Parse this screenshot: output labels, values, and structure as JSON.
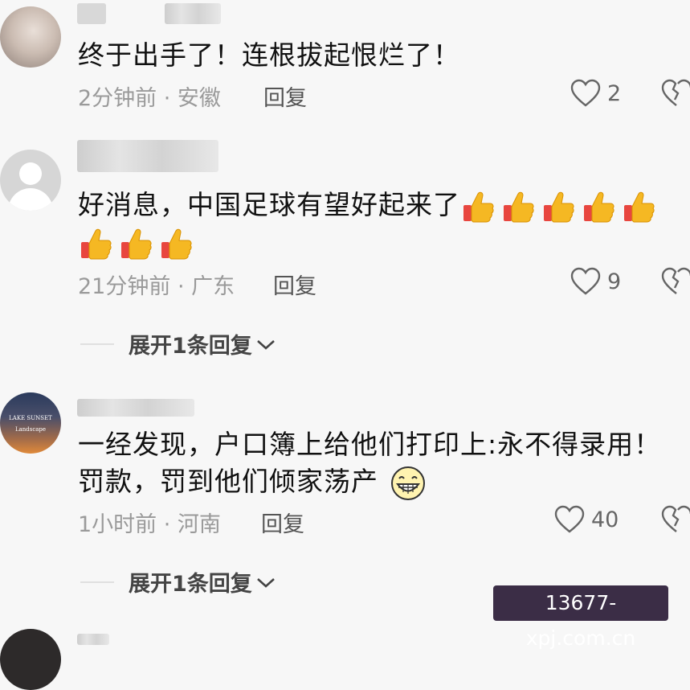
{
  "comments": [
    {
      "text": "终于出手了！连根拔起恨烂了！",
      "time": "2分钟前",
      "location": "安徽",
      "meta": "2分钟前 · 安徽",
      "reply_label": "回复",
      "likes": "2",
      "avatar": "photo-avatar"
    },
    {
      "text_line1": "好消息，中国足球有望好起来了",
      "thumbs_count": 8,
      "time": "21分钟前",
      "location": "广东",
      "meta": "21分钟前 · 广东",
      "reply_label": "回复",
      "likes": "9",
      "expand_label": "展开1条回复",
      "avatar": "default-avatar"
    },
    {
      "text_line1": "一经发现，户口簿上给他们打印上:永不得录用！",
      "text_line2": "罚款，罚到他们倾家荡产",
      "time": "1小时前",
      "location": "河南",
      "meta": "1小时前 · 河南",
      "reply_label": "回复",
      "likes": "40",
      "expand_label": "展开1条回复",
      "avatar": "sunset-avatar"
    }
  ],
  "watermark": "13677-xpj.com.cn",
  "colors": {
    "background": "#f7f7f7",
    "meta": "#9a9a9a",
    "watermark_bg": "#3b2d46",
    "thumb": "#f5b823"
  },
  "icons": [
    "heart-icon",
    "broken-heart-icon",
    "chevron-down-icon",
    "thumbs-up-icon",
    "grinning-face-icon"
  ]
}
